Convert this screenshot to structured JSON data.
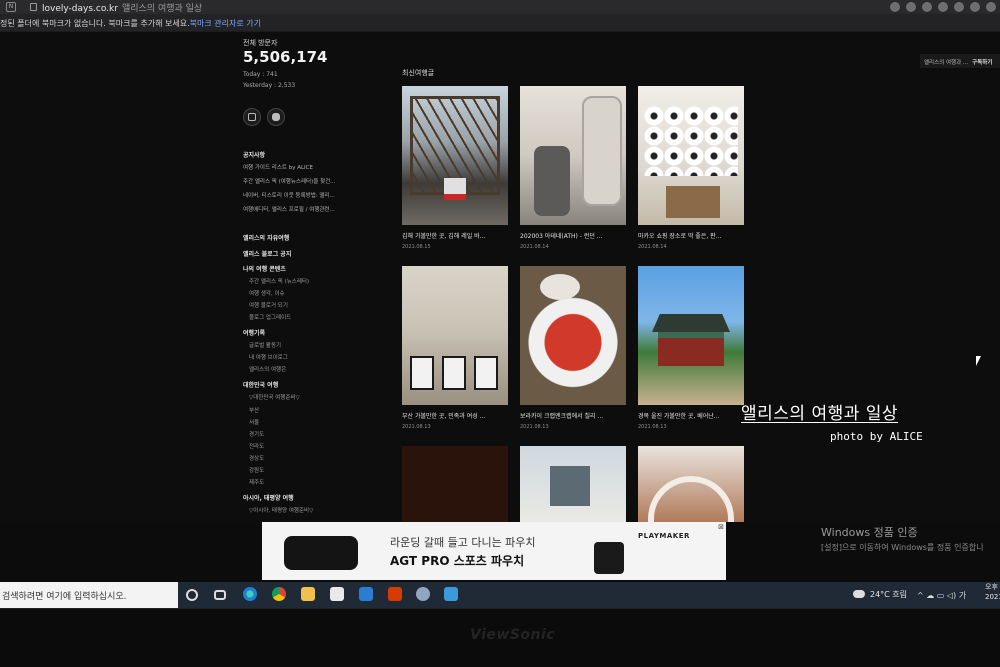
{
  "browser": {
    "url_domain": "lovely-days.co.kr",
    "tab_title": "앨리스의 여행과 일상",
    "bookmark_notice": "정된 폴더에 북마크가 없습니다. 북마크를 추가해 보세요.",
    "bookmark_link": "북마크 관리자로 가기"
  },
  "subscribe_bar": {
    "blog_name": "앨리스의 여행과 ...",
    "subscribe_label": "구독하기"
  },
  "sidebar": {
    "visitor_label": "전체 방문자",
    "visitor_total": "5,506,174",
    "today": "Today : 741",
    "yesterday": "Yesterday : 2,533",
    "notice_heading": "공지사항",
    "notices": [
      "여행 가이드 리스트 by ALICE",
      "주간 앨리스 픽 (여행뉴스레터)을 찾건...",
      "네이버, 티스토리 이웃 등록방법: 앨리...",
      "여행에디터, 앨리스 프로필 / 여행관련..."
    ],
    "categories": [
      {
        "label": "앨리스의 자유여행",
        "type": "head"
      },
      {
        "label": "앨리스 블로그 공지",
        "type": "head"
      },
      {
        "label": "나의 여행 콘텐츠",
        "type": "head"
      },
      {
        "label": "주간 앨리스 픽 (뉴스레터)",
        "type": "sub"
      },
      {
        "label": "여행 생각, 이슈",
        "type": "sub"
      },
      {
        "label": "여행 블로거 되기",
        "type": "sub"
      },
      {
        "label": "블로그 업그레이드",
        "type": "sub"
      },
      {
        "label": "여행기록",
        "type": "head"
      },
      {
        "label": "글로벌 활동기",
        "type": "sub"
      },
      {
        "label": "내 여행 브이로그",
        "type": "sub"
      },
      {
        "label": "앨리스의 여행은",
        "type": "sub"
      },
      {
        "label": "대한민국 여행",
        "type": "head"
      },
      {
        "label": "▽대한민국 여행준비▽",
        "type": "sub"
      },
      {
        "label": "부산",
        "type": "sub"
      },
      {
        "label": "서울",
        "type": "sub"
      },
      {
        "label": "경기도",
        "type": "sub"
      },
      {
        "label": "전라도",
        "type": "sub"
      },
      {
        "label": "경상도",
        "type": "sub"
      },
      {
        "label": "강원도",
        "type": "sub"
      },
      {
        "label": "제주도",
        "type": "sub"
      },
      {
        "label": "아시아, 태평양 여행",
        "type": "head"
      },
      {
        "label": "▽아시아, 태평양 여행준비▽",
        "type": "sub"
      }
    ]
  },
  "main": {
    "section_title": "최신여행글",
    "posts": [
      {
        "title": "김해 가볼만한 곳, 김해 레일 바...",
        "date": "2021.08.15"
      },
      {
        "title": "202003 아테네(ATH) - 런던 ...",
        "date": "2021.08.14"
      },
      {
        "title": "마카오 쇼핑 장소로 딱 좋은, 판...",
        "date": "2021.08.14"
      },
      {
        "title": "부산 가볼만한 곳, 민족과 여성 ...",
        "date": "2021.08.13"
      },
      {
        "title": "보라카이 크랩엔크랩에서 칠리 ...",
        "date": "2021.08.13"
      },
      {
        "title": "경복 울진 가볼만한 곳, 베어난...",
        "date": "2021.08.13"
      },
      {
        "title": "",
        "date": ""
      },
      {
        "title": "",
        "date": ""
      },
      {
        "title": "",
        "date": ""
      }
    ]
  },
  "overlay": {
    "title": "앨리스의 여행과 일상",
    "credit": "photo by ALICE"
  },
  "ad": {
    "line1": "라운딩 갈때 들고 다니는 파우치",
    "line2": "AGT PRO 스포츠 파우치",
    "brand": "PLAYMAKER",
    "close": "⊠"
  },
  "windows": {
    "activation_title": "Windows 정품 인증",
    "activation_text": "[설정]으로 이동하여 Windows를 정품 인증합니",
    "search_placeholder": "검색하려면 여기에 입력하십시오.",
    "weather": "24°C  흐림",
    "tray": "^ ☁ ▭ ◁) 가",
    "clock_line1": "오후",
    "clock_line2": "2021"
  },
  "monitor": {
    "brand": "ViewSonic"
  }
}
